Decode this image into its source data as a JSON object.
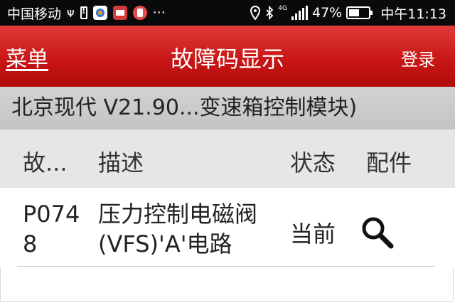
{
  "status_bar": {
    "carrier": "中国移动",
    "network_tag": "4G",
    "battery_percent": "47%",
    "time": "中午11:13",
    "icons": [
      "usb-debug-icon",
      "battery-warning-icon",
      "app-icon",
      "calendar-icon",
      "notification-app-icon",
      "more-dots-icon",
      "location-icon",
      "bluetooth-icon",
      "signal-icon",
      "battery-icon"
    ],
    "more": "···"
  },
  "action_bar": {
    "menu_label": "菜单",
    "title": "故障码显示",
    "login_label": "登录",
    "color": "#c71414"
  },
  "module_bar": {
    "text": "北京现代 V21.90...变速箱控制模块)"
  },
  "table": {
    "headers": [
      "故...",
      "描述",
      "状态",
      "配件"
    ],
    "rows": [
      {
        "code": "P0748",
        "description": "压力控制电磁阀(VFS)'A'电路",
        "status": "当前",
        "action_icon": "search-icon"
      }
    ]
  }
}
